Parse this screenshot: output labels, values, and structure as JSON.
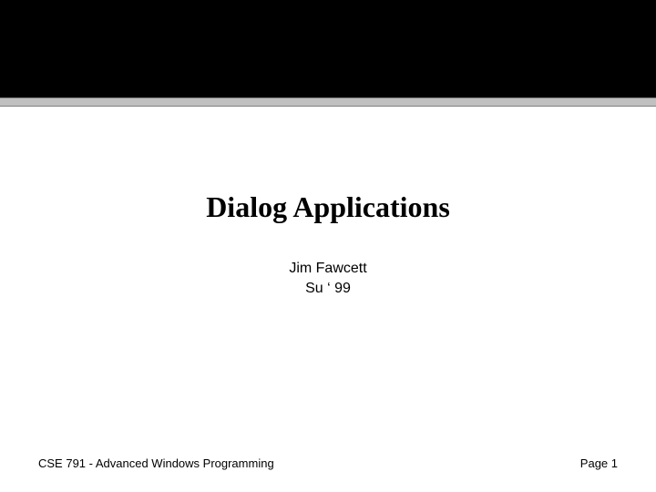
{
  "slide": {
    "title": "Dialog Applications",
    "author": "Jim Fawcett",
    "term": "Su ‘ 99"
  },
  "footer": {
    "course": "CSE 791 - Advanced Windows Programming",
    "page": "Page 1"
  }
}
